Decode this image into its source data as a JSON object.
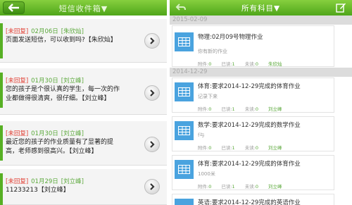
{
  "left": {
    "title": "短信收件箱▼",
    "messages": [
      {
        "status": "[未回复]",
        "date": "02月06日",
        "name": "[朱欣灿]",
        "body": "页面发送短信，可以收到吗?【朱欣灿】"
      },
      {
        "status": "[未回复]",
        "date": "01月30日",
        "name": "[刘立峰]",
        "body": "您的孩子是个很认真的学生，每一次的作业都做得很清爽，很仔细。【刘立峰】"
      },
      {
        "status": "[未回复]",
        "date": "01月30日",
        "name": "[刘立峰]",
        "body": "最近您的孩子的作业质量有了显著的提高，老师感到很高兴。【刘立峰】"
      },
      {
        "status": "[未回复]",
        "date": "01月29日",
        "name": "[刘立峰]",
        "body": "11233213【刘立峰】"
      }
    ]
  },
  "right": {
    "title": "所有科目▼",
    "groups": [
      {
        "date": "2015-02-09"
      },
      {
        "date": "2014-12-29"
      }
    ],
    "cards": [
      {
        "title": "物理:02月09号物理作业",
        "sub": "你有新的作业",
        "att_label": "附件:",
        "att": "0",
        "read_label": "已读:",
        "read": "1",
        "unread_label": "未读:",
        "unread": "0",
        "teacher": "朱欣灿"
      },
      {
        "title": "体育:要求2014-12-29完成的体育作业",
        "sub": "记录下来",
        "att_label": "附件:",
        "att": "0",
        "read_label": "已读:",
        "read": "1",
        "unread_label": "未读:",
        "unread": "0",
        "teacher": "刘立峰"
      },
      {
        "title": "数学:要求2014-12-29完成的数学作业",
        "sub": "f与",
        "att_label": "附件:",
        "att": "0",
        "read_label": "已读:",
        "read": "1",
        "unread_label": "未读:",
        "unread": "0",
        "teacher": "刘立峰"
      },
      {
        "title": "体育:要求2014-12-29完成的体育作业",
        "sub": "1000米",
        "att_label": "附件:",
        "att": "0",
        "read_label": "已读:",
        "read": "1",
        "unread_label": "未读:",
        "unread": "0",
        "teacher": "刘立峰"
      },
      {
        "title": "英语:要求2014-12-29完成的英语作业",
        "sub": "",
        "att_label": "",
        "att": "",
        "read_label": "",
        "read": "",
        "unread_label": "",
        "unread": "",
        "teacher": ""
      }
    ]
  },
  "colors": {
    "green_top": "#86cf3e",
    "green_bottom": "#4fa61a",
    "accent_blue": "#4aa3df",
    "unreplied_red": "#e03a2e"
  },
  "icons": [
    "back-arrow-icon",
    "chevron-right-icon",
    "edit-icon",
    "document-table-icon"
  ]
}
